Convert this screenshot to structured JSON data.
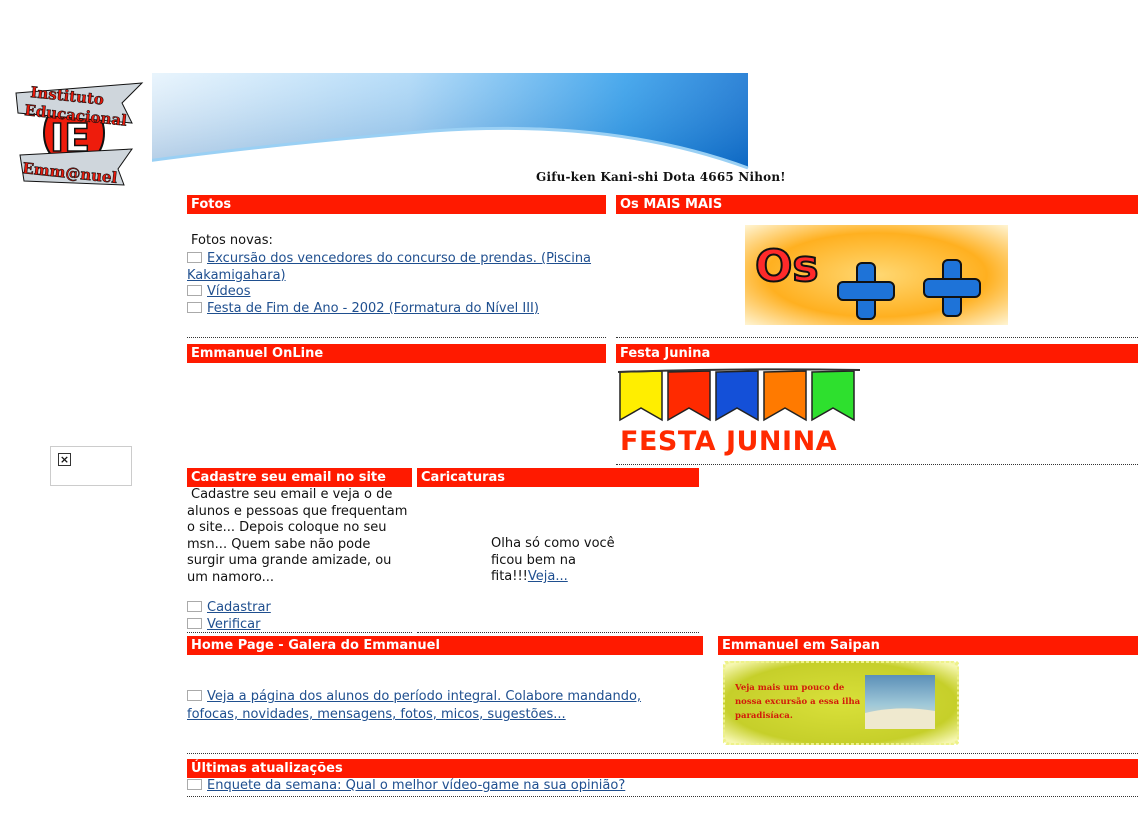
{
  "header": {
    "logo_lines": [
      "Instituto",
      "Educacional",
      "IE",
      "Emm@nuel"
    ],
    "address": "Gifu-ken Kani-shi Dota 4665 Nihon!"
  },
  "fotos": {
    "title": "Fotos",
    "intro": "Fotos novas:",
    "links": [
      "Excursão dos vencedores do concurso de prendas. (Piscina Kakamigahara)",
      "Vídeos",
      "Festa de Fim de Ano - 2002 (Formatura do Nível III)"
    ]
  },
  "mais": {
    "title": "Os MAIS MAIS",
    "image_text": "Os + +"
  },
  "online": {
    "title": "Emmanuel OnLine"
  },
  "junina": {
    "title": "Festa Junina",
    "image_text": "FESTA JUNINA",
    "flag_colors": [
      "#ffee00",
      "#ff2a00",
      "#1450d8",
      "#ff7a00",
      "#2ee02e"
    ]
  },
  "cadastre": {
    "title": "Cadastre seu email no site",
    "text": "Cadastre seu email e veja o de alunos e pessoas que frequentam o site... Depois coloque no seu msn... Quem sabe não pode surgir uma grande amizade, ou um namoro...",
    "links": [
      "Cadastrar",
      "Verificar"
    ]
  },
  "caricaturas": {
    "title": "Caricaturas",
    "text": "Olha só como você ficou bem na fita!!!",
    "link": "Veja..."
  },
  "homepage": {
    "title": "Home Page - Galera do Emmanuel",
    "link": "Veja a página dos alunos do período integral. Colabore mandando, fofocas, novidades, mensagens, fotos, micos, sugestões..."
  },
  "saipan": {
    "title": "Emmanuel em Saipan",
    "image_text": "Veja mais um pouco de nossa excursão a essa ilha paradisíaca."
  },
  "ultimas": {
    "title": "Últimas atualizações",
    "link": "Enquete da semana: Qual o melhor vídeo-game na sua opinião?"
  },
  "colors": {
    "bar": "#ff1a00",
    "link": "#1f4f8f",
    "banner_blue": "#1e90e6"
  }
}
